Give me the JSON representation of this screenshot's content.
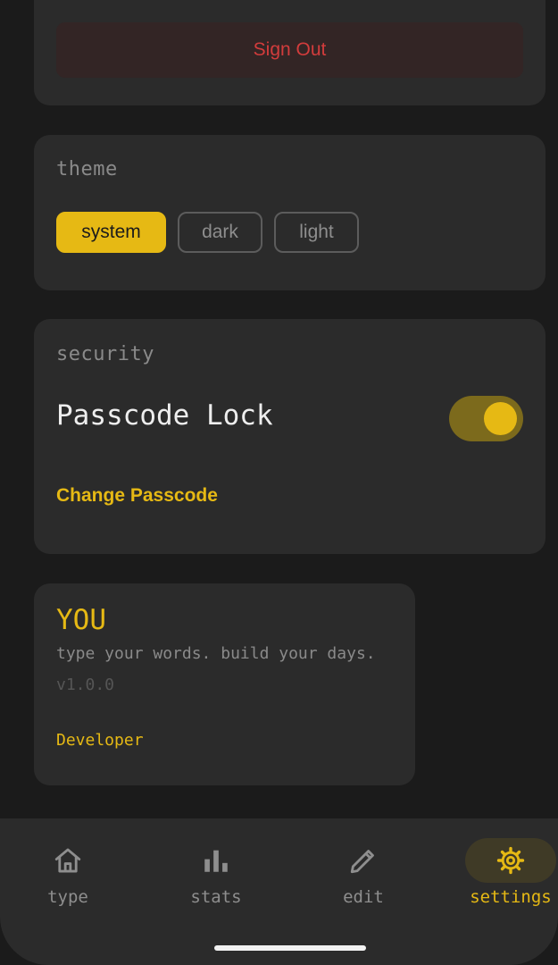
{
  "account": {
    "signout_label": "Sign Out"
  },
  "theme": {
    "title": "theme",
    "options": [
      "system",
      "dark",
      "light"
    ],
    "selected": "system"
  },
  "security": {
    "title": "security",
    "passcode_label": "Passcode Lock",
    "passcode_enabled": true,
    "change_passcode_label": "Change Passcode"
  },
  "about": {
    "app_name": "YOU",
    "tagline": "type your words. build your days.",
    "version": "v1.0.0",
    "developer_label": "Developer"
  },
  "nav": {
    "items": [
      {
        "label": "type",
        "icon": "home-icon"
      },
      {
        "label": "stats",
        "icon": "bar-chart-icon"
      },
      {
        "label": "edit",
        "icon": "pencil-icon"
      },
      {
        "label": "settings",
        "icon": "gear-icon"
      }
    ],
    "active": "settings"
  },
  "colors": {
    "accent": "#e6b914",
    "danger": "#d23c3c",
    "background": "#1b1b1b",
    "card": "#2b2b2b"
  }
}
